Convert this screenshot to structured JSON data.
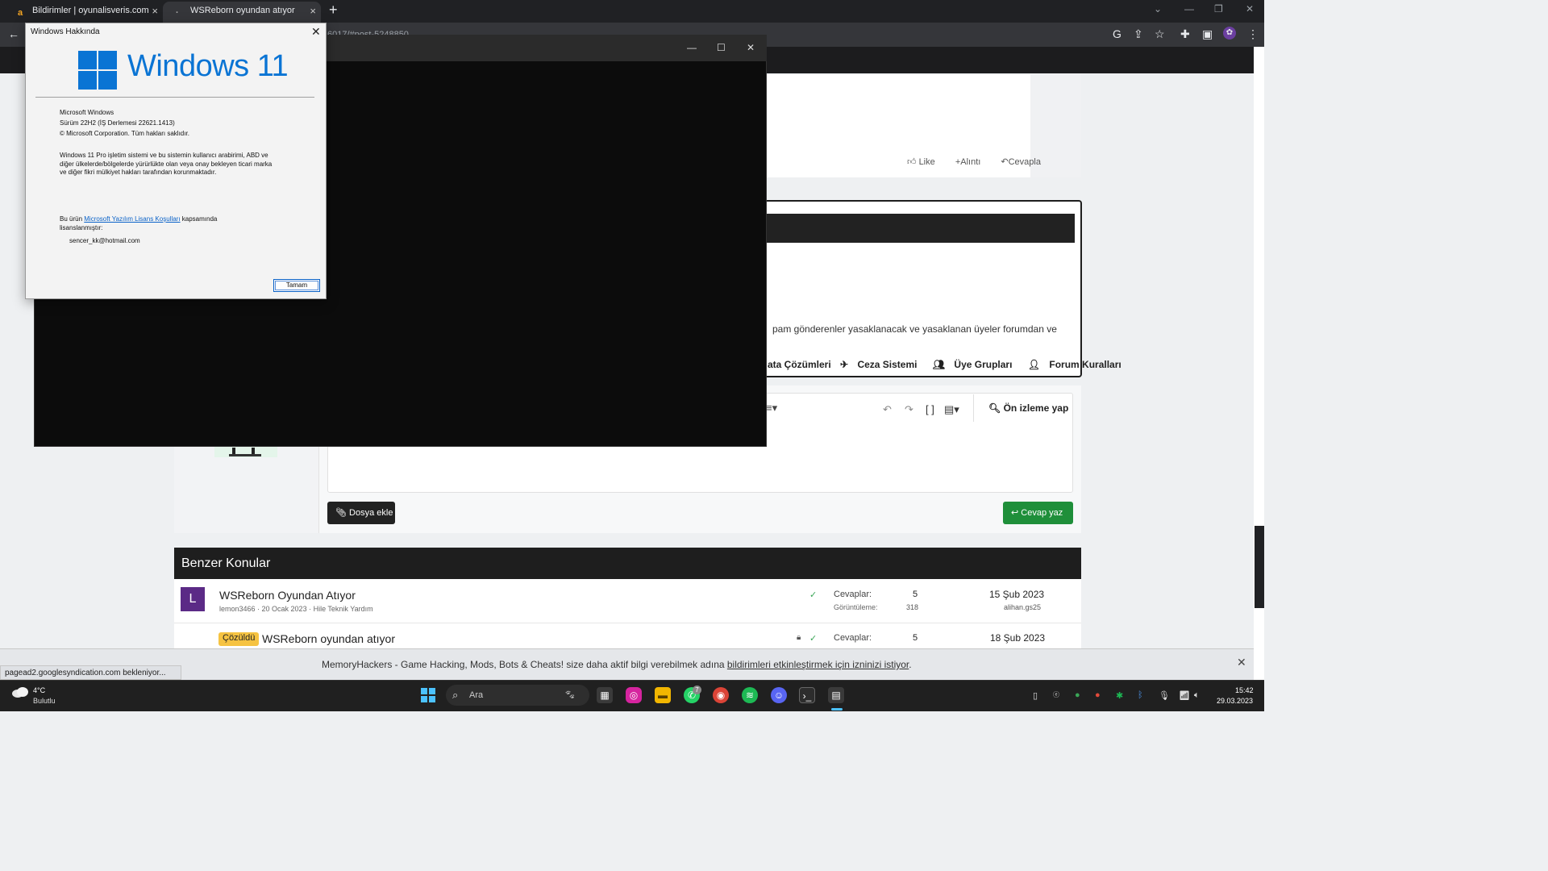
{
  "browser": {
    "tabs": [
      {
        "title": "Bildirimler | oyunalisveris.com",
        "favicon": "a",
        "close": "×"
      },
      {
        "title": "WSReborn oyundan atıyor",
        "favicon": "·",
        "close": "×"
      }
    ],
    "new_tab": "+",
    "url": "6017/#post-5248850",
    "status_url": "pagead2.googlesyndication.com bekleniyor..."
  },
  "post": {
    "actions": {
      "like": "Like",
      "quote": "Alıntı",
      "reply": "Cevapla"
    }
  },
  "notice": {
    "text": "pam gönderenler yasaklanacak ve yasaklanan üyeler forumdan ve",
    "links": [
      "ata Çözümleri",
      "Ceza Sistemi",
      "Üye Grupları",
      "Forum Kuralları"
    ]
  },
  "editor": {
    "preview": "Ön izleme yap",
    "attach": "Dosya ekle",
    "submit": "Cevap yaz"
  },
  "similar": {
    "title": "Benzer Konular",
    "threads": [
      {
        "avatar": "L",
        "title": "WSReborn Oyundan Atıyor",
        "meta": "lemon3466 · 20 Ocak 2023 · Hile Teknik Yardım",
        "replies_label": "Cevaplar:",
        "replies": "5",
        "views_label": "Görüntüleme:",
        "views": "318",
        "date": "15 Şub 2023",
        "by": "alihan.gs25"
      },
      {
        "badge": "Çözüldü",
        "title": "WSReborn oyundan atıyor",
        "replies_label": "Cevaplar:",
        "replies": "5",
        "date": "18 Şub 2023"
      }
    ]
  },
  "notification": {
    "text": "MemoryHackers - Game Hacking, Mods, Bots & Cheats! size daha aktif bilgi verebilmek adına ",
    "link": "bildirimleri etkinleştirmek için izninizi istiyor",
    "tail": "."
  },
  "dialog": {
    "title": "Windows Hakkında",
    "logo_text": "Windows 11",
    "product": "Microsoft Windows",
    "version": "Sürüm 22H2 (İŞ Derlemesi 22621.1413)",
    "copyright": "© Microsoft Corporation. Tüm hakları saklıdır.",
    "legal1": "Windows 11 Pro işletim sistemi ve bu sistemin kullanıcı arabirimi, ABD ve",
    "legal2": "diğer ülkelerde/bölgelerde yürürlükte olan veya onay bekleyen ticari marka",
    "legal3": "ve diğer fikri mülkiyet hakları tarafından korunmaktadır.",
    "license_pre": "Bu ürün ",
    "license_link": "Microsoft Yazılım Lisans Koşulları",
    "license_post": " kapsamında",
    "license_line2": "lisanslanmıştır:",
    "user": "sencer_kk@hotmail.com",
    "ok": "Tamam"
  },
  "taskbar": {
    "weather_temp": "4°C",
    "weather_desc": "Bulutlu",
    "search": "Ara",
    "time": "15:42",
    "date": "29.03.2023",
    "whatsapp_badge": "7"
  },
  "colors": {
    "accent_windows": "#0a74d4",
    "forum_green": "#1f8f3a",
    "solved_badge": "#f6c342",
    "avatar_purple": "#5b2a86"
  }
}
